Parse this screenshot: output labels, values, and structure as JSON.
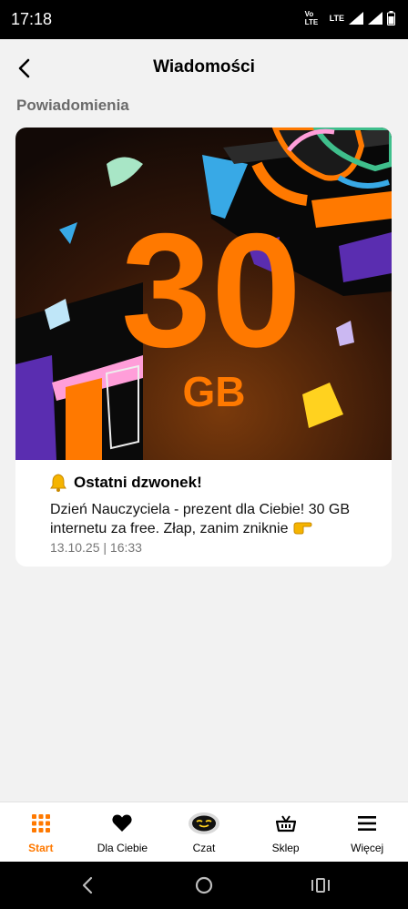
{
  "status_bar": {
    "time": "17:18",
    "network": "Vo LTE",
    "lte": "LTE"
  },
  "header": {
    "title": "Wiadomości"
  },
  "section": {
    "title": "Powiadomienia"
  },
  "notification": {
    "banner": {
      "amount": "30",
      "unit": "GB"
    },
    "title": "Ostatni dzwonek!",
    "body": "Dzień Nauczyciela - prezent dla Ciebie! 30 GB internetu za free. Złap, zanim zniknie",
    "date": "13.10.25 | 16:33"
  },
  "bottom_nav": {
    "items": [
      {
        "label": "Start",
        "icon": "grid-icon",
        "active": true
      },
      {
        "label": "Dla Ciebie",
        "icon": "heart-icon"
      },
      {
        "label": "Czat",
        "icon": "chat-bot-icon"
      },
      {
        "label": "Sklep",
        "icon": "basket-icon"
      },
      {
        "label": "Więcej",
        "icon": "menu-icon"
      }
    ]
  },
  "colors": {
    "accent": "#ff7900",
    "background": "#f2f2f2",
    "banner_dark": "#1c0e08"
  }
}
